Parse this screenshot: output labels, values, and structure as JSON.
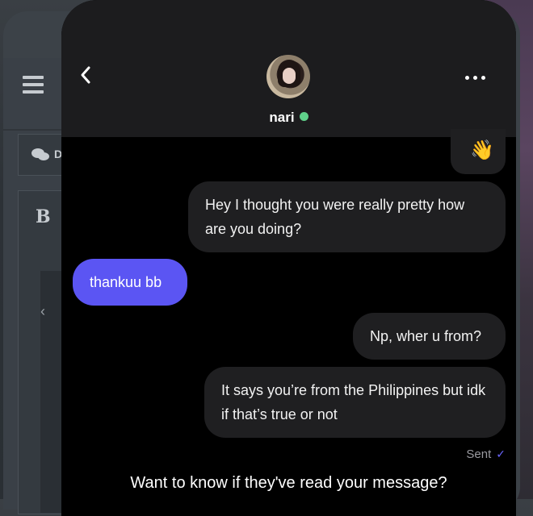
{
  "background_app": {
    "chat_tab_label": "D",
    "bold_label": "B",
    "arrow": "‹"
  },
  "header": {
    "back_icon": "‹",
    "contact_name": "nari",
    "status": "online"
  },
  "messages": [
    {
      "direction": "outgoing",
      "text": "👋"
    },
    {
      "direction": "outgoing",
      "text": "Hey I thought you were really pretty how are you doing?"
    },
    {
      "direction": "incoming",
      "text": "thankuu bb"
    },
    {
      "direction": "outgoing",
      "text": "Np, wher u from?"
    },
    {
      "direction": "outgoing",
      "text": "It says you’re from the Philippines but idk if that’s true or not"
    }
  ],
  "delivery_status": "Sent",
  "read_receipt_prompt": "Want to know if they've read your message?",
  "colors": {
    "incoming_bubble": "#5b55f3",
    "outgoing_bubble": "#1f1f21",
    "online_dot": "#5fd18a",
    "sent_check": "#6b66ff"
  }
}
